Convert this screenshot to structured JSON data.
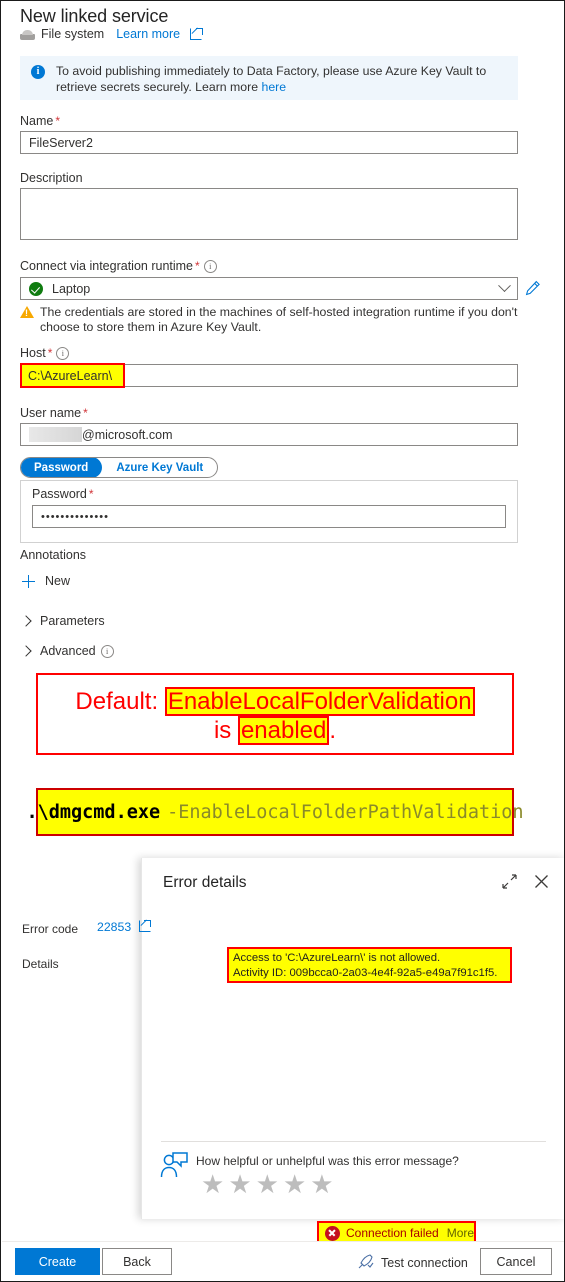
{
  "header": {
    "title": "New linked service",
    "service_type": "File system",
    "learn_more": "Learn more"
  },
  "banner": {
    "text_before": "To avoid publishing immediately to Data Factory, please use Azure Key Vault to retrieve secrets securely. Learn more ",
    "link": "here"
  },
  "form": {
    "name_label": "Name",
    "name_value": "FileServer2",
    "description_label": "Description",
    "description_value": "",
    "runtime_label": "Connect via integration runtime",
    "runtime_value": "Laptop",
    "warning": "The credentials are stored in the machines of self-hosted integration runtime if you don't choose to store them in Azure Key Vault.",
    "host_label": "Host",
    "host_value": "C:\\AzureLearn\\",
    "username_label": "User name",
    "username_value": "@microsoft.com",
    "auth_tab_password": "Password",
    "auth_tab_keyvault": "Azure Key Vault",
    "password_label": "Password",
    "password_value": "••••••••••••••",
    "annotations_label": "Annotations",
    "new_label": "New",
    "parameters_label": "Parameters",
    "advanced_label": "Advanced"
  },
  "callout": {
    "line1_prefix": "Default:",
    "line1_highlight": "EnableLocalFolderValidation",
    "line2_prefix": "is",
    "line2_highlight": "enabled",
    "line2_suffix": ".",
    "command_exe": ".\\dmgcmd.exe",
    "command_arg": "-EnableLocalFolderPathValidation"
  },
  "error_panel": {
    "title": "Error details",
    "error_code_label": "Error code",
    "error_code_value": "22853",
    "details_label": "Details",
    "details_line1": "Access to 'C:\\AzureLearn\\' is not allowed.",
    "details_line2": "Activity ID: 009bcca0-2a03-4e4f-92a5-e49a7f91c1f5.",
    "feedback_question": "How helpful or unhelpful was this error message?",
    "star_glyph": "★",
    "star_count": 5
  },
  "status": {
    "text": "Connection failed",
    "more": "More"
  },
  "commandbar": {
    "create": "Create",
    "back": "Back",
    "test_connection": "Test connection",
    "cancel": "Cancel"
  },
  "colors": {
    "accent": "#0078d4",
    "error": "#c50f1f",
    "success": "#107c10",
    "warning": "#f7a800",
    "annotation": "#ff0000",
    "highlight": "#ffff00"
  }
}
